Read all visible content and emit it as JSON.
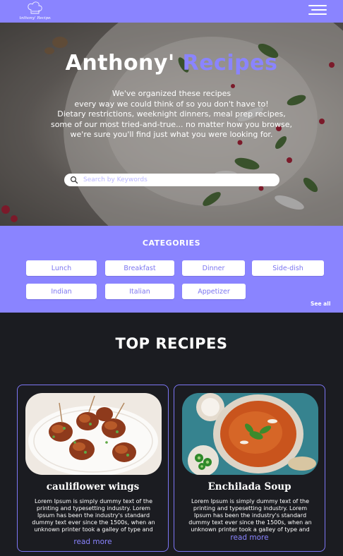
{
  "header": {
    "logo_text": "Anthony' Recipes",
    "menu_icon": "hamburger-menu-icon",
    "background": "#8a84ff"
  },
  "hero": {
    "title_main": "Anthony'",
    "title_accent": "Recipes",
    "text_lines": [
      "We've organized these recipes",
      "every way we could think of so you don't have to!",
      "Dietary restrictions, weeknight dinners, meal prep recipes,",
      "some of our most tried-and-true... no matter how you browse,",
      "we're sure you'll find just what you were looking for."
    ],
    "search": {
      "placeholder": "Search by Keywords",
      "value": "",
      "icon": "search-icon"
    }
  },
  "categories": {
    "title": "CATEGORIES",
    "items": [
      "Lunch",
      "Breakfast",
      "Dinner",
      "Side-dish",
      "Indian",
      "Italian",
      "Appetizer"
    ],
    "see_all": "See all"
  },
  "top_recipes": {
    "title": "TOP RECIPES",
    "cards": [
      {
        "name": "cauliflower wings",
        "description": "Lorem Ipsum is simply dummy text of the printing and typesetting industry. Lorem Ipsum has been the industry's standard dummy text ever since the 1500s, when an unknown printer took a galley of type and",
        "link": "read more"
      },
      {
        "name": "Enchilada Soup",
        "description": "Lorem Ipsum is simply dummy text of the printing and typesetting industry. Lorem Ipsum has been the industry's standard dummy text ever since the 1500s, when an unknown printer took a galley of type and",
        "link": "read more"
      }
    ]
  },
  "colors": {
    "accent": "#8a84ff",
    "page_background": "#1b1c21",
    "card_border": "#7d76f5"
  }
}
